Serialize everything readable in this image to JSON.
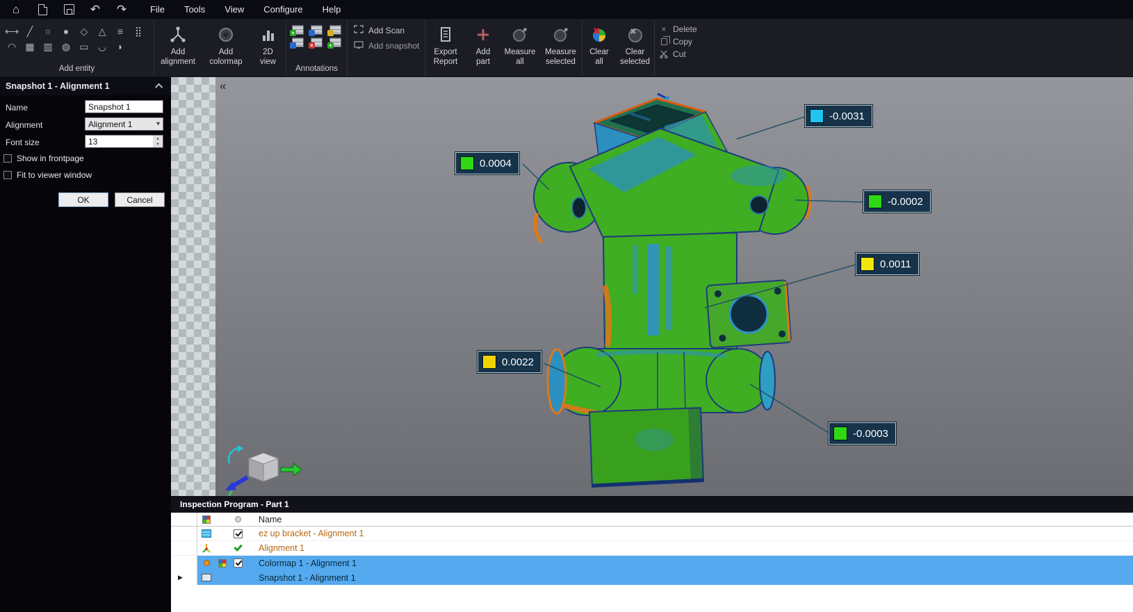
{
  "menubar": {
    "items": [
      {
        "label": "File"
      },
      {
        "label": "Tools"
      },
      {
        "label": "View"
      },
      {
        "label": "Configure"
      },
      {
        "label": "Help"
      }
    ]
  },
  "icons": {
    "home": "⌂",
    "undo": "↶",
    "redo": "↷",
    "collapse_left": "«",
    "delete": "×",
    "dropdown": "▾",
    "spin_up": "▴",
    "spin_down": "▾",
    "row_marker": "▶",
    "annotation_badge_plus": "+",
    "annotation_badge_x": "×"
  },
  "toolbar": {
    "add_entity_label": "Add entity",
    "entity_icons_row1": [
      "⟷",
      "╱",
      "○",
      "●",
      "◇",
      "△",
      "≡",
      "⣿"
    ],
    "entity_icons_row2": [
      "◠",
      "▦",
      "▥",
      "◍",
      "▭",
      "◡",
      "◗"
    ],
    "add_alignment": "Add\nalignment",
    "add_colormap": "Add\ncolormap",
    "view_2d": "2D\nview",
    "annotations_label": "Annotations",
    "add_scan": "Add Scan",
    "add_snapshot": "Add snapshot",
    "export_report": "Export\nReport",
    "add_part": "Add\npart",
    "measure_all": "Measure\nall",
    "measure_selected": "Measure\nselected",
    "clear_all": "Clear\nall",
    "clear_selected": "Clear\nselected",
    "delete": "Delete",
    "copy": "Copy",
    "cut": "Cut"
  },
  "properties_panel": {
    "title": "Snapshot 1 - Alignment 1",
    "name_label": "Name",
    "name_value": "Snapshot 1",
    "alignment_label": "Alignment",
    "alignment_value": "Alignment 1",
    "font_size_label": "Font size",
    "font_size_value": "13",
    "show_in_frontpage": {
      "label": "Show in frontpage",
      "checked": false
    },
    "fit_to_viewer": {
      "label": "Fit to viewer window",
      "checked": false
    },
    "ok": "OK",
    "cancel": "Cancel"
  },
  "viewport": {
    "annotations": [
      {
        "value": "-0.0031",
        "color": "#1fc4ef"
      },
      {
        "value": "0.0004",
        "color": "#2fd813"
      },
      {
        "value": "-0.0002",
        "color": "#2fd813"
      },
      {
        "value": "0.0011",
        "color": "#f0e70c"
      },
      {
        "value": "0.0022",
        "color": "#efd400"
      },
      {
        "value": "-0.0003",
        "color": "#2fd813"
      }
    ]
  },
  "inspection_panel": {
    "title": "Inspection Program - Part 1",
    "name_column": "Name",
    "rows": [
      {
        "name": "ez up bracket - Alignment 1",
        "checked": true,
        "approved": false,
        "selected": false,
        "current": false
      },
      {
        "name": "Alignment 1",
        "checked": false,
        "approved": true,
        "selected": false,
        "current": false
      },
      {
        "name": "Colormap 1 - Alignment 1",
        "checked": true,
        "approved": false,
        "selected": true,
        "current": false
      },
      {
        "name": "Snapshot 1 - Alignment 1",
        "checked": false,
        "approved": false,
        "selected": true,
        "current": true
      }
    ]
  },
  "colors": {
    "selection": "#55a9ee",
    "model_green": "#3fae22",
    "model_blue": "#2b8fc0",
    "model_orange": "#e0761a"
  }
}
